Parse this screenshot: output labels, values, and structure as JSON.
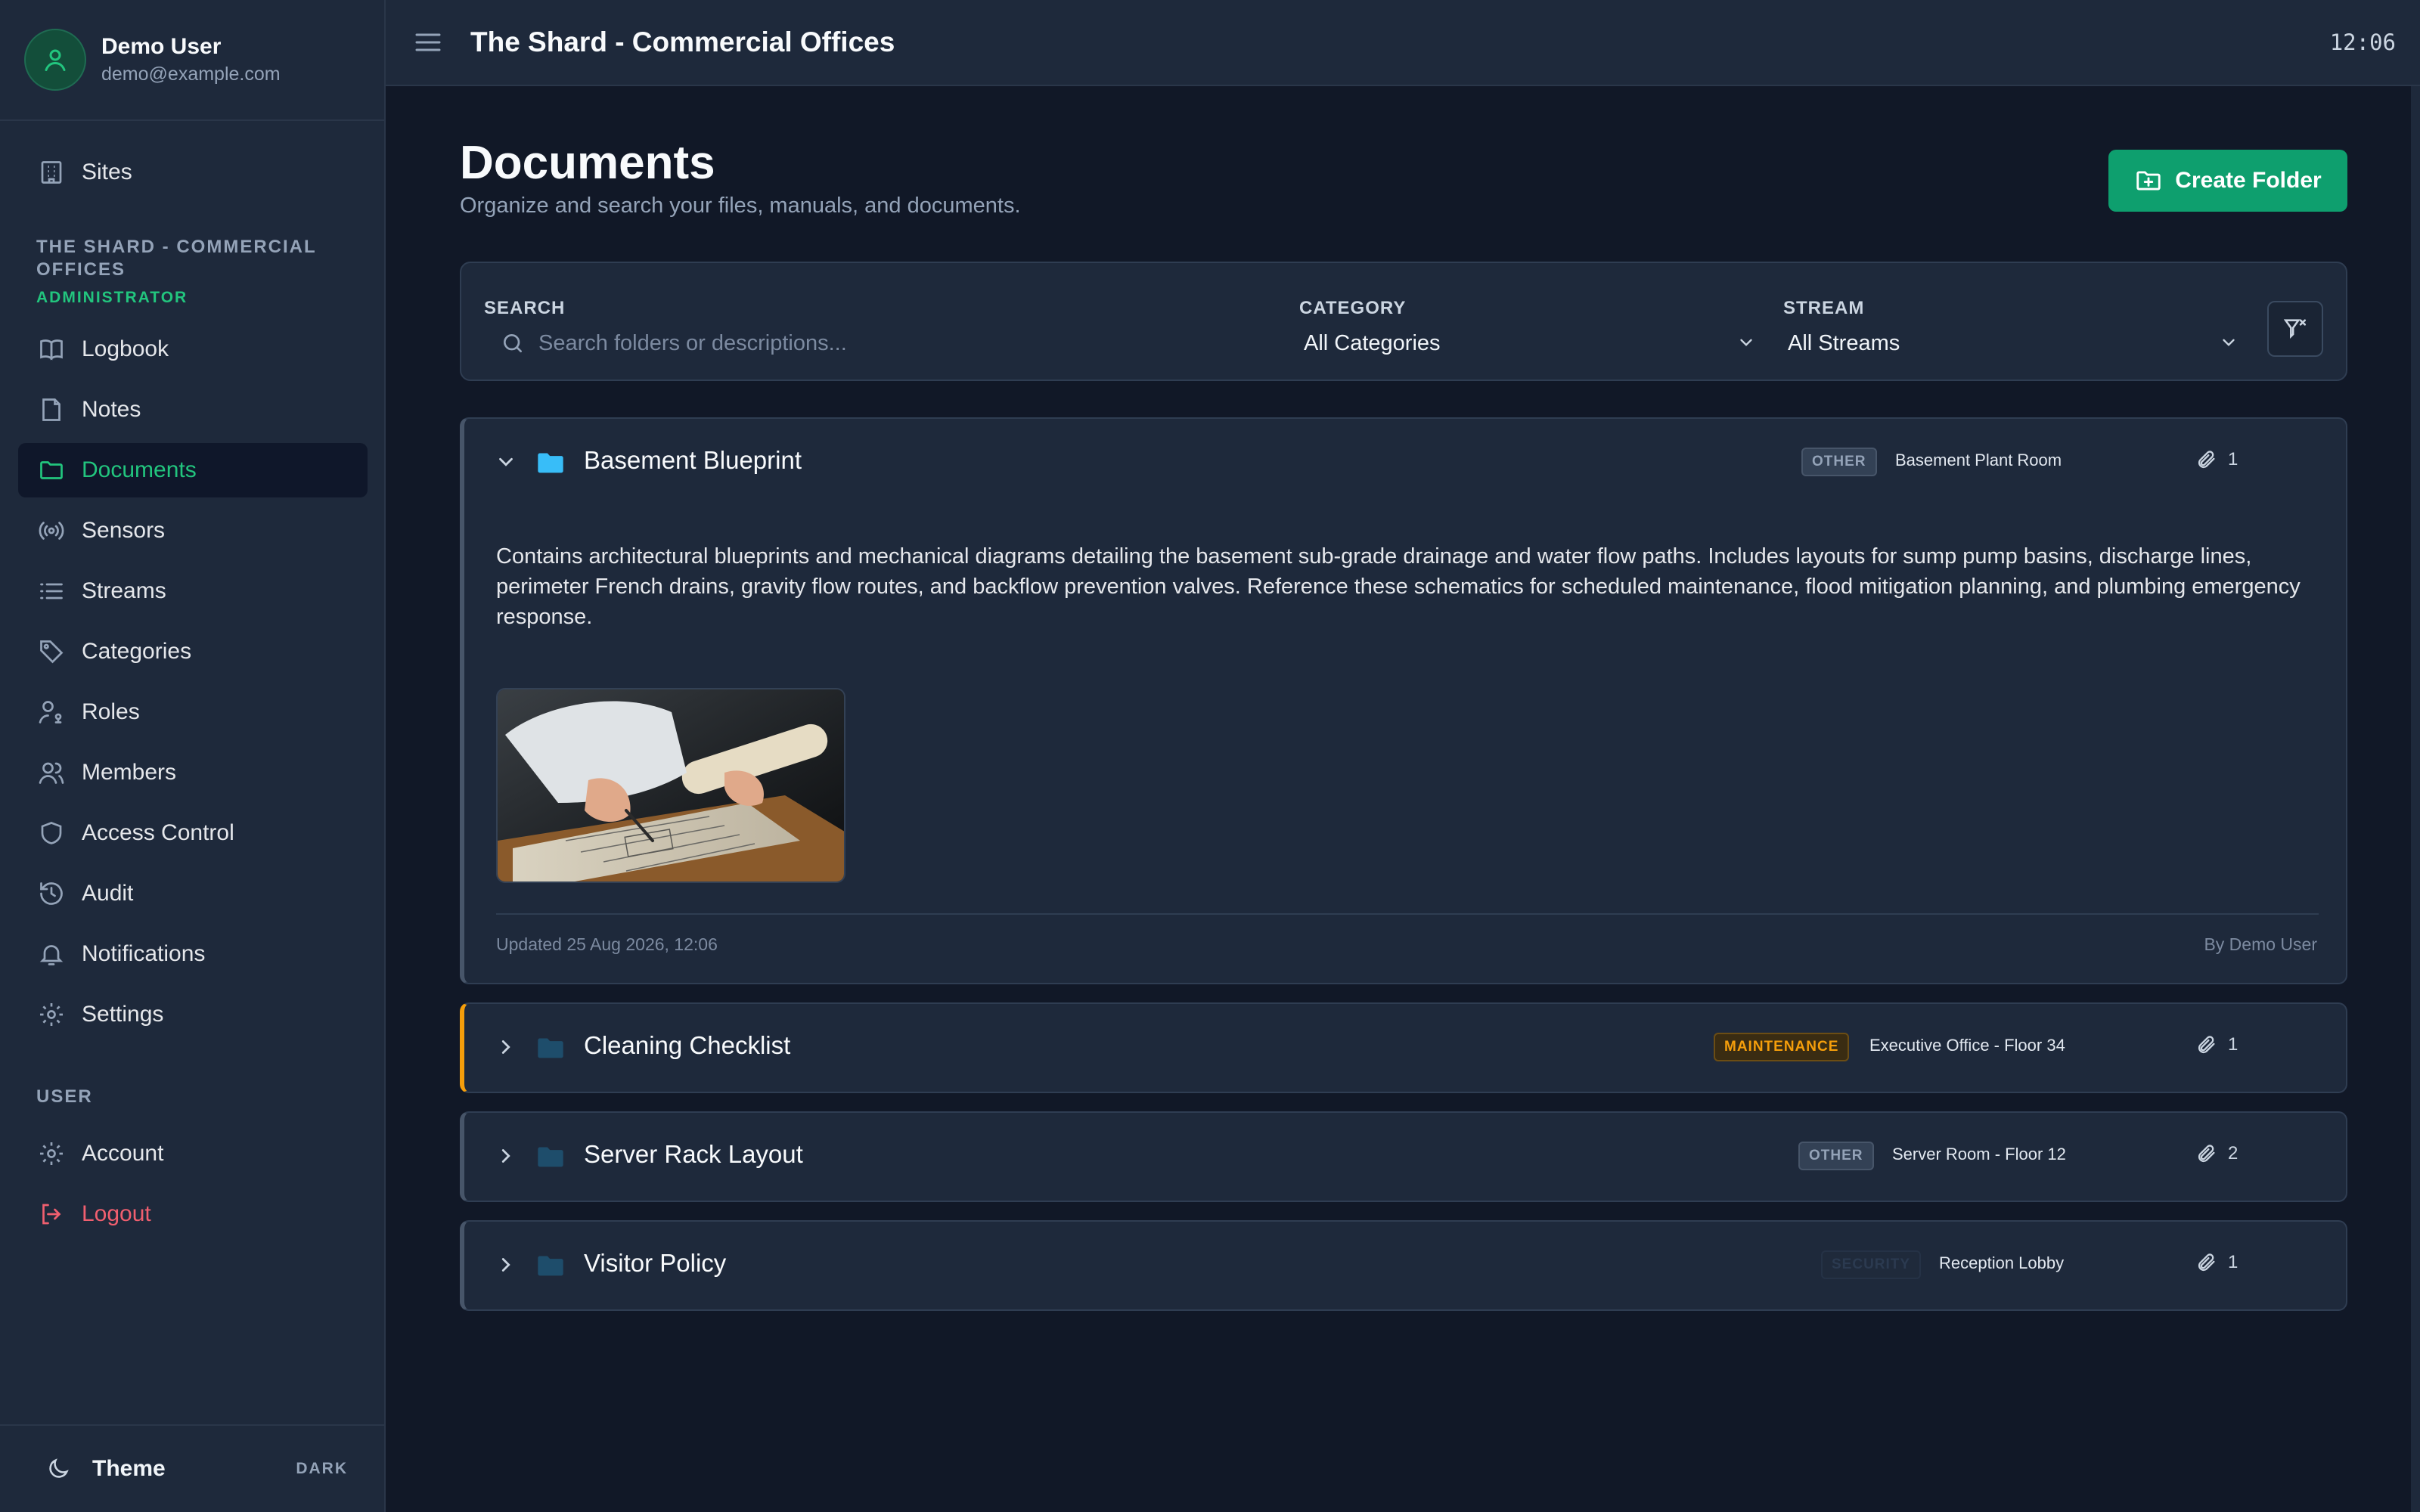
{
  "user": {
    "name": "Demo User",
    "email": "demo@example.com"
  },
  "nav": {
    "sites": "Sites",
    "site_section": "THE SHARD - COMMERCIAL OFFICES",
    "role": "ADMINISTRATOR",
    "items": [
      {
        "label": "Logbook",
        "icon": "book-icon"
      },
      {
        "label": "Notes",
        "icon": "note-icon"
      },
      {
        "label": "Documents",
        "icon": "folder-icon",
        "active": true
      },
      {
        "label": "Sensors",
        "icon": "sensor-icon"
      },
      {
        "label": "Streams",
        "icon": "list-icon"
      },
      {
        "label": "Categories",
        "icon": "tag-icon"
      },
      {
        "label": "Roles",
        "icon": "user-key-icon"
      },
      {
        "label": "Members",
        "icon": "users-icon"
      },
      {
        "label": "Access Control",
        "icon": "shield-icon"
      },
      {
        "label": "Audit",
        "icon": "history-icon"
      },
      {
        "label": "Notifications",
        "icon": "bell-icon"
      },
      {
        "label": "Settings",
        "icon": "gear-icon"
      }
    ],
    "user_section": "USER",
    "user_items": [
      {
        "label": "Account",
        "icon": "gear-icon"
      },
      {
        "label": "Logout",
        "icon": "logout-icon"
      }
    ]
  },
  "theme": {
    "label": "Theme",
    "mode": "DARK"
  },
  "topbar": {
    "title": "The Shard - Commercial Offices",
    "clock": "12:06"
  },
  "page": {
    "title": "Documents",
    "subtitle": "Organize and search your files, manuals, and documents.",
    "create_label": "Create Folder"
  },
  "filters": {
    "search_label": "SEARCH",
    "search_placeholder": "Search folders or descriptions...",
    "category_label": "CATEGORY",
    "category_value": "All Categories",
    "stream_label": "STREAM",
    "stream_value": "All Streams"
  },
  "folders": [
    {
      "name": "Basement Blueprint",
      "category": "OTHER",
      "location": "Basement Plant Room",
      "attachments": "1",
      "expanded": true,
      "description": "Contains architectural blueprints and mechanical diagrams detailing the basement sub-grade drainage and water flow paths. Includes layouts for sump pump basins, discharge lines, perimeter French drains, gravity flow routes, and backflow prevention valves. Reference these schematics for scheduled maintenance, flood mitigation planning, and plumbing emergency response.",
      "updated": "Updated 25 Aug 2026, 12:06",
      "by": "By Demo User"
    },
    {
      "name": "Cleaning Checklist",
      "category": "MAINTENANCE",
      "location": "Executive Office - Floor 34",
      "attachments": "1"
    },
    {
      "name": "Server Rack Layout",
      "category": "OTHER",
      "location": "Server Room - Floor 12",
      "attachments": "2"
    },
    {
      "name": "Visitor Policy",
      "category": "SECURITY",
      "location": "Reception Lobby",
      "attachments": "1"
    }
  ],
  "colors": {
    "accent": "#0e9f6e",
    "active_nav": "#22c57e",
    "maintenance": "#f59e0b",
    "logout": "#f05f6f"
  }
}
